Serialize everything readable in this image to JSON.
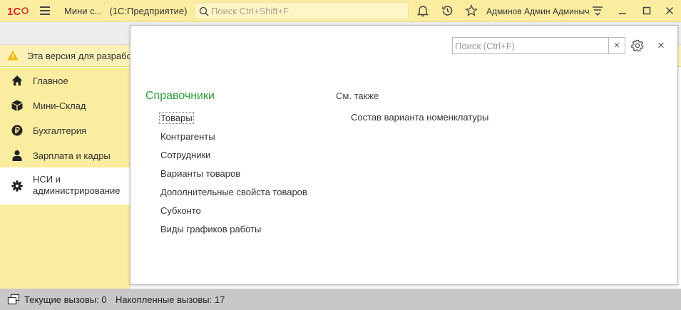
{
  "titlebar": {
    "app_name": "Мини с...",
    "platform": "(1С:Предприятие)",
    "search_placeholder": "Поиск Ctrl+Shift+F",
    "user": "Админов Админ Админыч",
    "icons": [
      "1c-logo",
      "menu-icon",
      "search-icon",
      "bell-icon",
      "history-icon",
      "star-icon",
      "settings-lines-icon",
      "minimize-icon",
      "maximize-icon",
      "close-icon"
    ]
  },
  "warning": {
    "text": "Эта версия для разрабо"
  },
  "sidebar": {
    "items": [
      {
        "label": "Главное",
        "icon": "home-icon"
      },
      {
        "label": "Мини-Склад",
        "icon": "box-icon"
      },
      {
        "label": "Бухгалтерия",
        "icon": "ruble-coin-icon"
      },
      {
        "label": "Зарплата и кадры",
        "icon": "person-icon"
      },
      {
        "label_line1": "НСИ и",
        "label_line2": "администрирование",
        "icon": "gear-icon",
        "active": true
      }
    ]
  },
  "panel": {
    "search_placeholder": "Поиск (Ctrl+F)",
    "clear_label": "×",
    "close_label": "×",
    "section_title": "Справочники",
    "links": [
      "Товары",
      "Контрагенты",
      "Сотрудники",
      "Варианты товаров",
      "Дополнительные свойста товаров",
      "Субконто",
      "Виды графиков работы"
    ],
    "see_also_title": "См. также",
    "see_also_links": [
      "Состав варианта номенклатуры"
    ]
  },
  "statusbar": {
    "current_calls": "Текущие вызовы: 0",
    "accumulated_calls": "Накопленные вызовы: 17"
  },
  "colors": {
    "titlebar_bg": "#fbeda0",
    "sidebar_bg": "#fbeda0",
    "section_title": "#2e9e3a",
    "logo_red": "#d3282f",
    "warning_icon": "#f4b400",
    "status_bg": "#c8c8c8"
  }
}
